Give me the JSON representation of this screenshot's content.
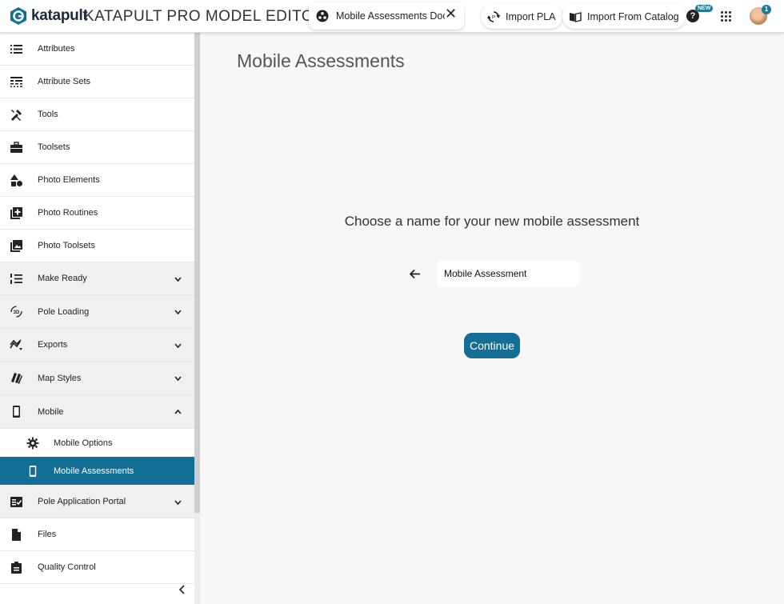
{
  "header": {
    "logo_text": "katapult",
    "app_title": "KATAPULT PRO MODEL EDITOR",
    "doc_tab_label": "Mobile Assessments Document",
    "import_pla_label": "Import PLA",
    "import_catalog_label": "Import From Catalog",
    "help_label": "?",
    "new_badge": "NEW",
    "notification_count": "1"
  },
  "sidebar": {
    "items": [
      {
        "label": "Attributes",
        "icon": "list-icon"
      },
      {
        "label": "Attribute Sets",
        "icon": "attribute-sets-icon"
      },
      {
        "label": "Tools",
        "icon": "tools-icon"
      },
      {
        "label": "Toolsets",
        "icon": "toolbox-icon"
      },
      {
        "label": "Photo Elements",
        "icon": "shapes-icon"
      },
      {
        "label": "Photo Routines",
        "icon": "add-photo-icon"
      },
      {
        "label": "Photo Toolsets",
        "icon": "photo-library-icon"
      },
      {
        "label": "Make Ready",
        "icon": "format-list-numbered-icon",
        "expandable": true
      },
      {
        "label": "Pole Loading",
        "icon": "3d-rotation-icon",
        "expandable": true
      },
      {
        "label": "Exports",
        "icon": "export-icon",
        "expandable": true
      },
      {
        "label": "Map Styles",
        "icon": "map-styles-icon",
        "expandable": true
      },
      {
        "label": "Mobile",
        "icon": "phone-icon",
        "expandable": true,
        "expanded": true
      },
      {
        "label": "Pole Application Portal",
        "icon": "fact-check-icon",
        "expandable": true
      },
      {
        "label": "Files",
        "icon": "file-icon"
      },
      {
        "label": "Quality Control",
        "icon": "clipboard-icon"
      }
    ],
    "mobile_sub": [
      {
        "label": "Mobile Options",
        "icon": "gear-icon"
      },
      {
        "label": "Mobile Assessments",
        "icon": "phone-icon",
        "active": true
      }
    ]
  },
  "main": {
    "title": "Mobile Assessments",
    "prompt": "Choose a name for your new mobile assessment",
    "name_input_value": "Mobile Assessment",
    "continue_label": "Continue"
  },
  "colors": {
    "accent": "#136f96",
    "badge": "#1a7a9e",
    "background": "#f7f7f7"
  }
}
